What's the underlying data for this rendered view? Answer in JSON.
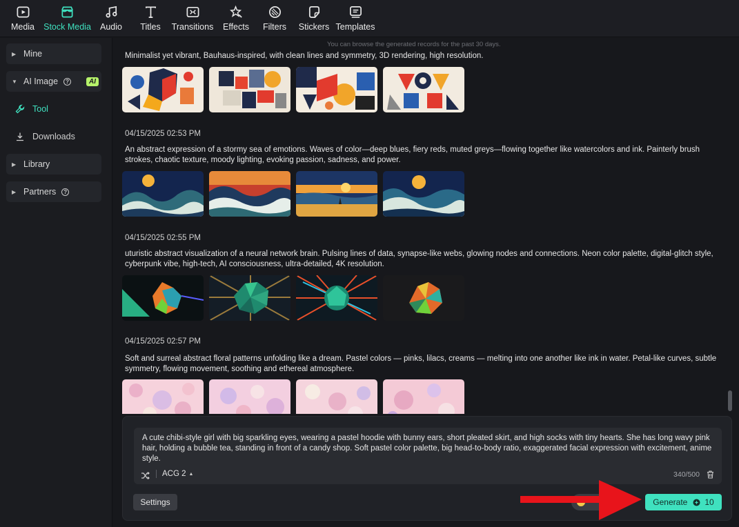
{
  "toolbar": {
    "items": [
      {
        "label": "Media",
        "icon": "media-icon"
      },
      {
        "label": "Stock Media",
        "icon": "stock-media-icon",
        "active": true
      },
      {
        "label": "Audio",
        "icon": "audio-icon"
      },
      {
        "label": "Titles",
        "icon": "titles-icon"
      },
      {
        "label": "Transitions",
        "icon": "transitions-icon"
      },
      {
        "label": "Effects",
        "icon": "effects-icon"
      },
      {
        "label": "Filters",
        "icon": "filters-icon"
      },
      {
        "label": "Stickers",
        "icon": "stickers-icon"
      },
      {
        "label": "Templates",
        "icon": "templates-icon"
      }
    ],
    "accent_color": "#3fe1bf"
  },
  "sidebar": {
    "mine": "Mine",
    "ai_image": "AI Image",
    "ai_badge": "AI",
    "tool": "Tool",
    "downloads": "Downloads",
    "library": "Library",
    "partners": "Partners"
  },
  "main": {
    "hint": "You can browse the generated records for the past 30 days.",
    "records": [
      {
        "date": "",
        "prompt": "Minimalist yet vibrant, Bauhaus-inspired, with clean lines and symmetry, 3D rendering, high resolution."
      },
      {
        "date": "04/15/2025 02:53 PM",
        "prompt": "An abstract expression of a stormy sea of emotions. Waves of color—deep blues, fiery reds, muted greys—flowing together like watercolors and ink. Painterly brush strokes, chaotic texture, moody lighting, evoking passion, sadness, and power."
      },
      {
        "date": "04/15/2025 02:55 PM",
        "prompt": "uturistic abstract visualization of a neural network brain. Pulsing lines of data, synapse-like webs, glowing nodes and connections. Neon color palette, digital-glitch style, cyberpunk vibe, high-tech, AI consciousness, ultra-detailed, 4K resolution."
      },
      {
        "date": "04/15/2025 02:57 PM",
        "prompt": "Soft and surreal abstract floral patterns unfolding like a dream. Pastel colors — pinks, lilacs, creams — melting into one another like ink in water. Petal-like curves, subtle symmetry, flowing movement, soothing and ethereal atmosphere."
      }
    ]
  },
  "composer": {
    "prompt": "A cute chibi-style girl with big sparkling eyes, wearing a pastel hoodie with bunny ears, short pleated skirt, and high socks with tiny hearts. She has long wavy pink hair, holding a bubble tea, standing in front of a candy shop. Soft pastel color palette, big head-to-body ratio, exaggerated facial expression with excitement, anime style.",
    "style": "ACG 2",
    "char_count": "340/500",
    "settings_label": "Settings",
    "generate_label": "Generate",
    "generate_cost": "10",
    "generate_color": "#3fe1bf"
  },
  "annotation": {
    "arrow_color": "#e8141b"
  }
}
